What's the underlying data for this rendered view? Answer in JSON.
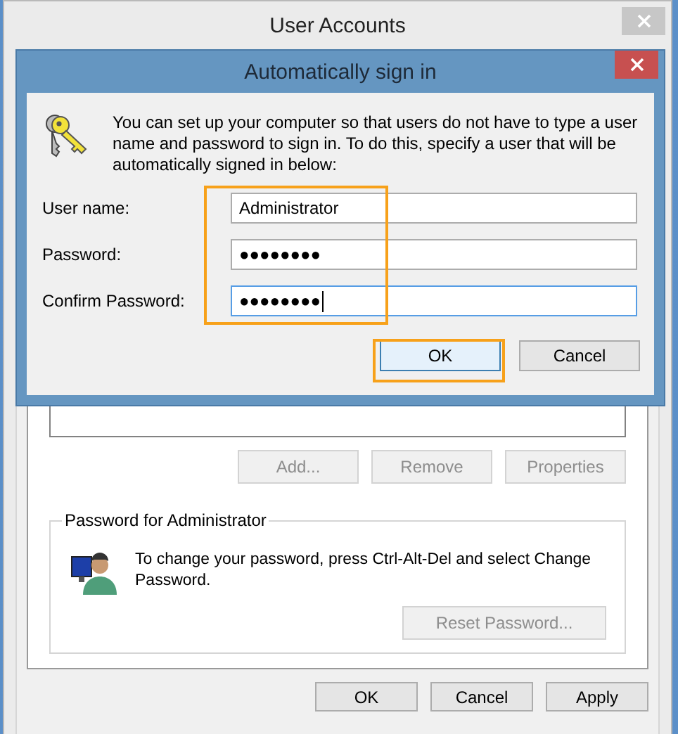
{
  "window": {
    "title": "User Accounts"
  },
  "list_buttons": [
    {
      "label": "Add...",
      "disabled": true
    },
    {
      "label": "Remove",
      "disabled": true
    },
    {
      "label": "Properties",
      "disabled": true
    }
  ],
  "password_group": {
    "title": "Password for Administrator",
    "text": "To change your password, press Ctrl-Alt-Del and select Change Password.",
    "button": {
      "label": "Reset Password...",
      "disabled": true
    }
  },
  "buttons": [
    {
      "label": "OK",
      "disabled": false
    },
    {
      "label": "Cancel",
      "disabled": false
    },
    {
      "label": "Apply",
      "disabled": false
    }
  ],
  "dialog": {
    "title": "Automatically sign in",
    "description": "You can set up your computer so that users do not have to type a user name and password to sign in. To do this, specify a user that will be automatically signed in below:",
    "fields": [
      {
        "label": "User name:",
        "value": "Administrator",
        "focused": false
      },
      {
        "label": "Password:",
        "value": "●●●●●●●●",
        "focused": false
      },
      {
        "label": "Confirm Password:",
        "value": "●●●●●●●●",
        "focused": true
      }
    ],
    "buttons": [
      {
        "label": "OK",
        "default": true
      },
      {
        "label": "Cancel",
        "default": false
      }
    ]
  }
}
